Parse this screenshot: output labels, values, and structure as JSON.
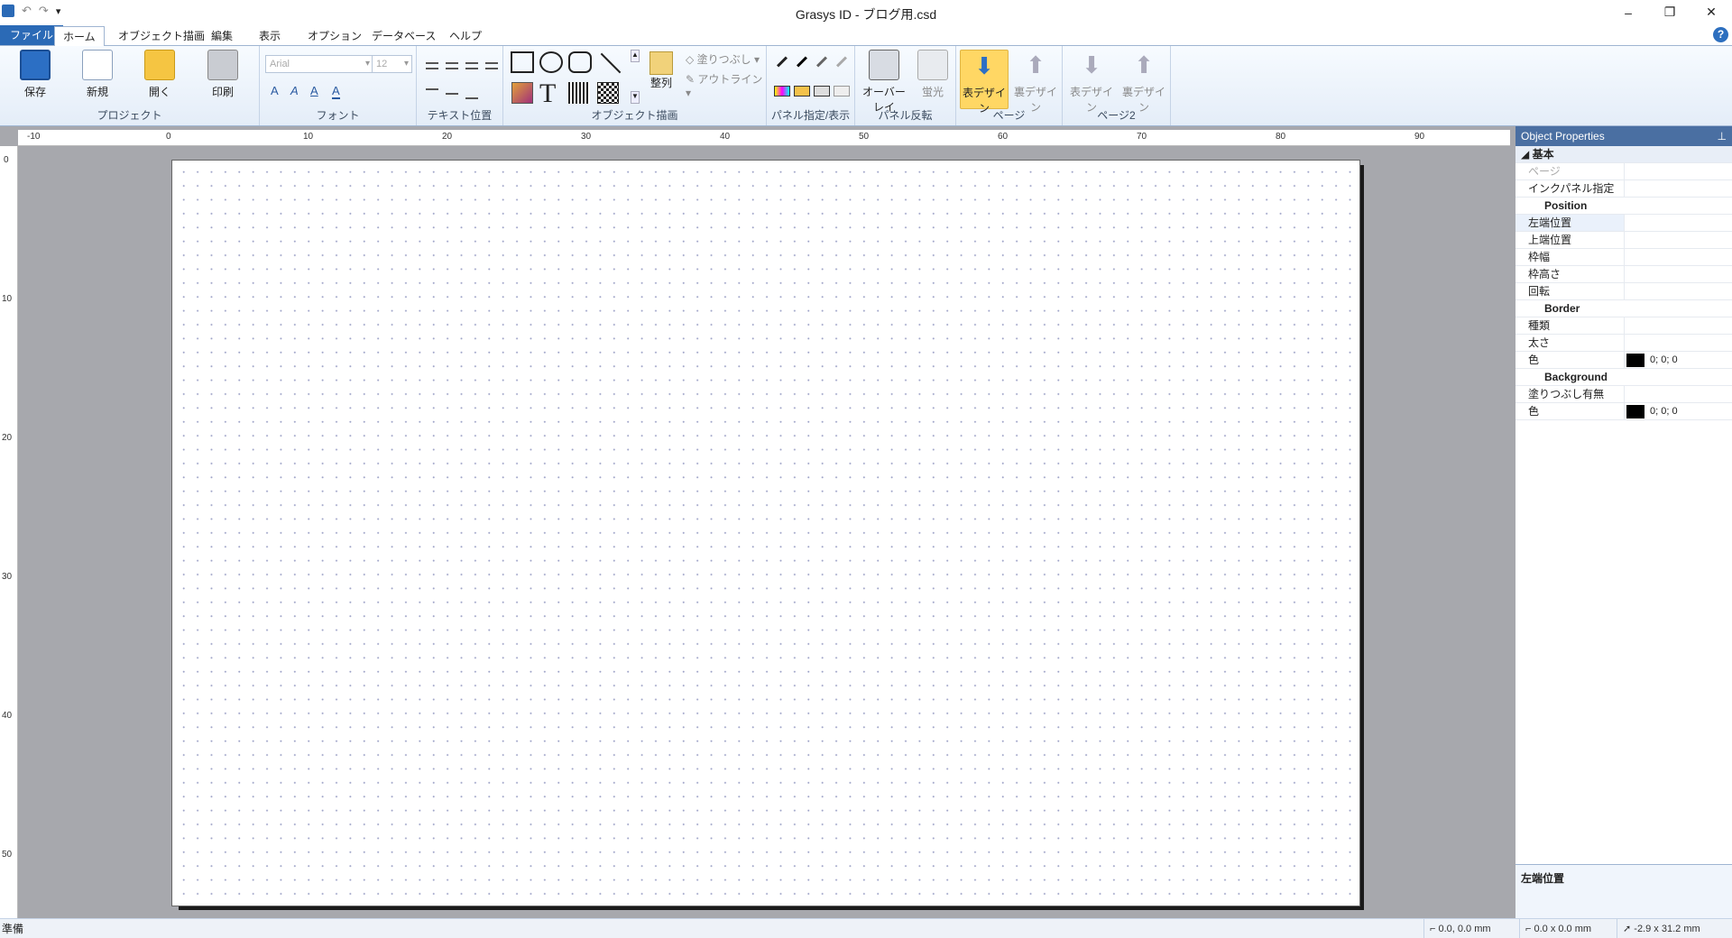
{
  "window": {
    "title": "Grasys ID - ブログ用.csd",
    "minimize": "–",
    "restore": "❐",
    "close": "✕"
  },
  "quick_access": {
    "undo": "↶",
    "redo": "↷",
    "more": "▾"
  },
  "menu": {
    "tabs": [
      "ファイル",
      "ホーム",
      "オブジェクト描画",
      "編集",
      "表示",
      "オプション",
      "データベース",
      "ヘルプ"
    ],
    "active": "ホーム",
    "help": "?"
  },
  "ribbon": {
    "project": {
      "label": "プロジェクト",
      "save": "保存",
      "new": "新規",
      "open": "開く",
      "print": "印刷"
    },
    "font": {
      "label": "フォント",
      "font_name": "Arial",
      "font_size": "12",
      "bold": "A",
      "italic": "A",
      "underline": "A",
      "color": "A"
    },
    "text_position": {
      "label": "テキスト位置"
    },
    "object_drawing": {
      "label": "オブジェクト描画",
      "arrange": "整列",
      "fill": "塗りつぶし",
      "outline": "アウトライン",
      "text_tool": "T"
    },
    "panel": {
      "label": "パネル指定/表示"
    },
    "panel_flip": {
      "label": "パネル反転",
      "overlay": "オーバーレイ",
      "fluor": "蛍光"
    },
    "page": {
      "label": "ページ",
      "front": "表デザイン",
      "back": "裏デザイン"
    },
    "page2": {
      "label": "ページ2",
      "front": "表デザイン",
      "back": "裏デザイン"
    }
  },
  "rulers": {
    "horizontal": [
      "-10",
      "0",
      "10",
      "20",
      "30",
      "40",
      "50",
      "60",
      "70",
      "80",
      "90"
    ],
    "vertical": [
      "0",
      "10",
      "20",
      "30",
      "40",
      "50"
    ]
  },
  "properties": {
    "title": "Object Properties",
    "pin": "📌",
    "rows": [
      {
        "type": "cat",
        "key": "◢ 基本"
      },
      {
        "type": "disabled",
        "key": "ページ"
      },
      {
        "type": "row",
        "key": "インクパネル指定"
      },
      {
        "type": "sub",
        "key": "Position"
      },
      {
        "type": "row",
        "key": "左端位置"
      },
      {
        "type": "row",
        "key": "上端位置"
      },
      {
        "type": "row",
        "key": "枠幅"
      },
      {
        "type": "row",
        "key": "枠高さ"
      },
      {
        "type": "row",
        "key": "回転"
      },
      {
        "type": "sub",
        "key": "Border"
      },
      {
        "type": "row",
        "key": "種類"
      },
      {
        "type": "row",
        "key": "太さ"
      },
      {
        "type": "color",
        "key": "色",
        "value": "0; 0; 0"
      },
      {
        "type": "sub",
        "key": "Background"
      },
      {
        "type": "row",
        "key": "塗りつぶし有無"
      },
      {
        "type": "color",
        "key": "色",
        "value": "0; 0; 0"
      }
    ],
    "description": "左端位置"
  },
  "status": {
    "ready": "準備",
    "position": "0.0, 0.0 mm",
    "size": "0.0 x 0.0 mm",
    "cursor": "-2.9 x 31.2 mm"
  },
  "colors": {
    "accent": "#2b6ab6",
    "selected": "#ffd764",
    "workspace": "#a7a8ad",
    "panel_header": "#4a6fa2"
  }
}
